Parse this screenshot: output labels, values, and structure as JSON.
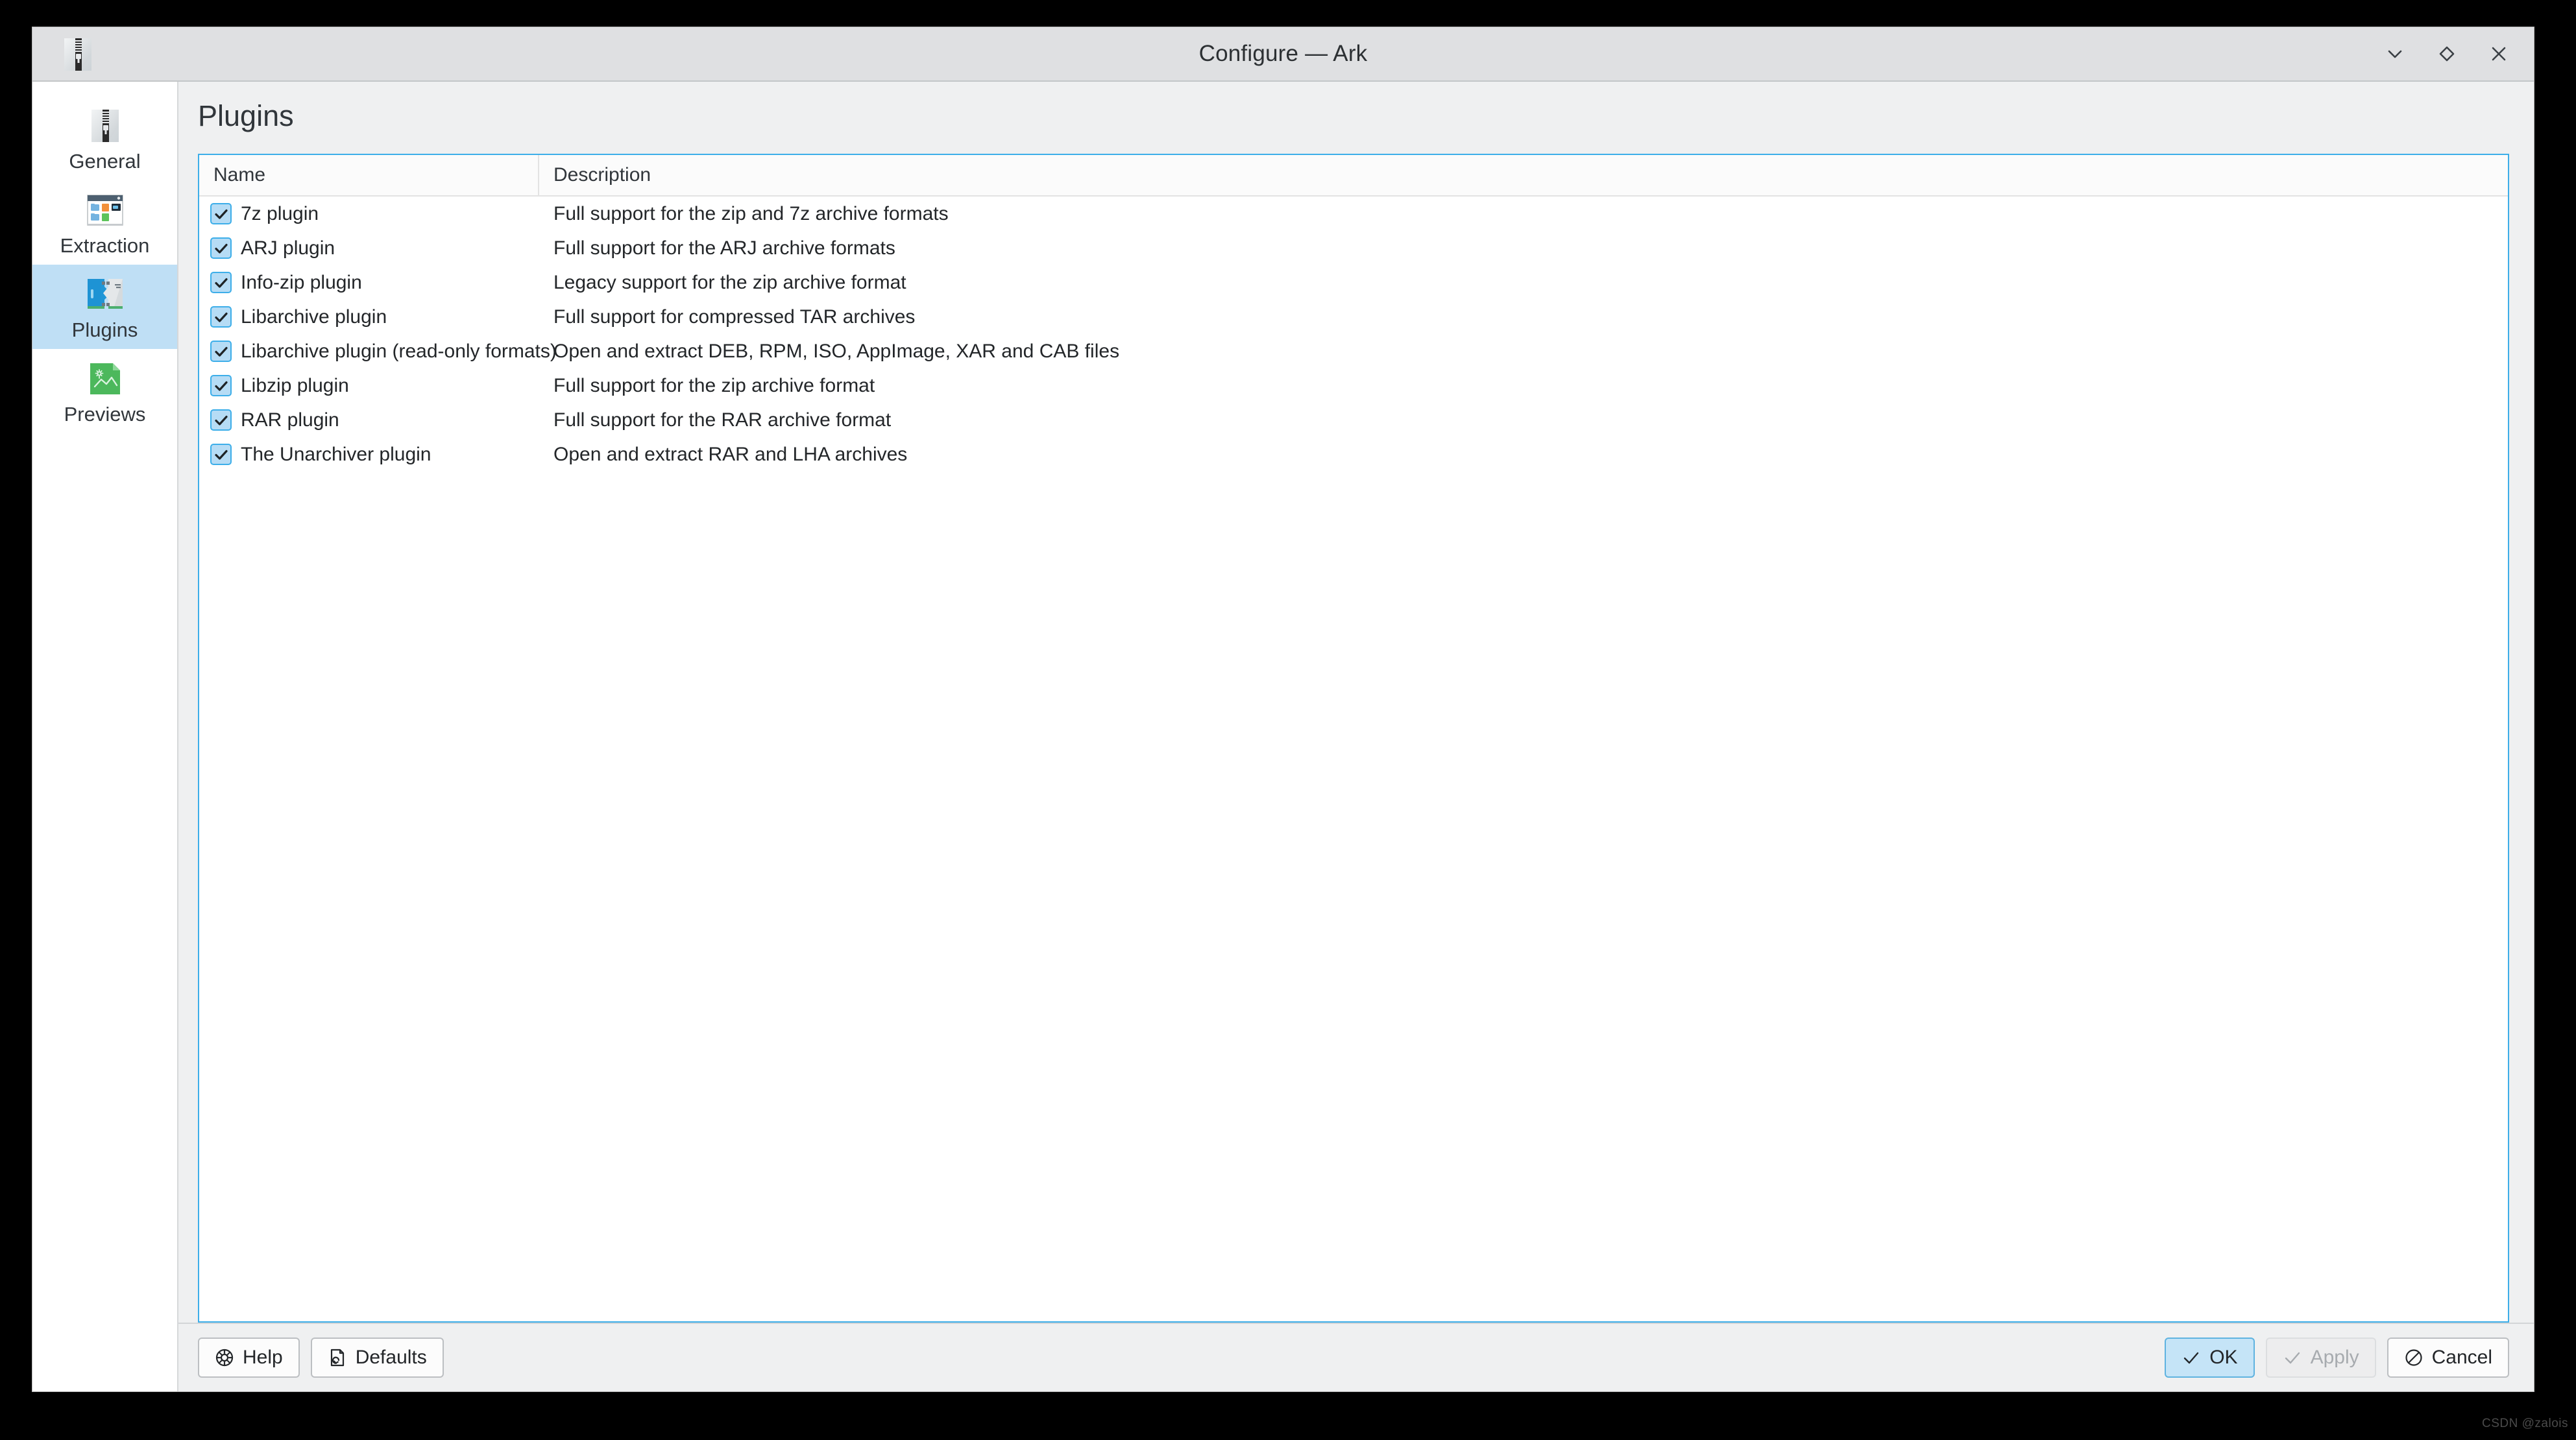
{
  "window": {
    "title": "Configure — Ark",
    "app_icon": "archive-zip-icon",
    "controls": [
      {
        "name": "minimize",
        "glyph": "chevron-down"
      },
      {
        "name": "maximize",
        "glyph": "diamond"
      },
      {
        "name": "close",
        "glyph": "x"
      }
    ]
  },
  "sidebar": {
    "items": [
      {
        "label": "General",
        "icon": "archive-zip-icon",
        "selected": false
      },
      {
        "label": "Extraction",
        "icon": "folder-window-icon",
        "selected": false
      },
      {
        "label": "Plugins",
        "icon": "plugin-puzzle-icon",
        "selected": true
      },
      {
        "label": "Previews",
        "icon": "image-preview-icon",
        "selected": false
      }
    ]
  },
  "page": {
    "title": "Plugins"
  },
  "table": {
    "columns": [
      "Name",
      "Description"
    ],
    "rows": [
      {
        "checked": true,
        "name": "7z plugin",
        "description": "Full support for the zip and 7z archive formats"
      },
      {
        "checked": true,
        "name": "ARJ plugin",
        "description": "Full support for the ARJ archive formats"
      },
      {
        "checked": true,
        "name": "Info-zip plugin",
        "description": "Legacy support for the zip archive format"
      },
      {
        "checked": true,
        "name": "Libarchive plugin",
        "description": "Full support for compressed TAR archives"
      },
      {
        "checked": true,
        "name": "Libarchive plugin (read-only formats)",
        "description": "Open and extract DEB, RPM, ISO, AppImage, XAR and CAB files"
      },
      {
        "checked": true,
        "name": "Libzip plugin",
        "description": "Full support for the zip archive format"
      },
      {
        "checked": true,
        "name": "RAR plugin",
        "description": "Full support for the RAR archive format"
      },
      {
        "checked": true,
        "name": "The Unarchiver plugin",
        "description": "Open and extract RAR and LHA archives"
      }
    ]
  },
  "footer": {
    "help_label": "Help",
    "help_icon": "lifebuoy-icon",
    "defaults_label": "Defaults",
    "defaults_icon": "document-revert-icon",
    "ok_label": "OK",
    "ok_icon": "check-icon",
    "apply_label": "Apply",
    "apply_icon": "check-icon",
    "apply_disabled": true,
    "cancel_label": "Cancel",
    "cancel_icon": "no-entry-icon"
  },
  "watermark": {
    "text": "CSDN @zalois"
  },
  "colors": {
    "accent": "#3daee9",
    "window_bg": "#eff0f1",
    "titlebar_bg": "#dfe0e2",
    "selection_bg": "#bfdff5",
    "text": "#232629"
  }
}
